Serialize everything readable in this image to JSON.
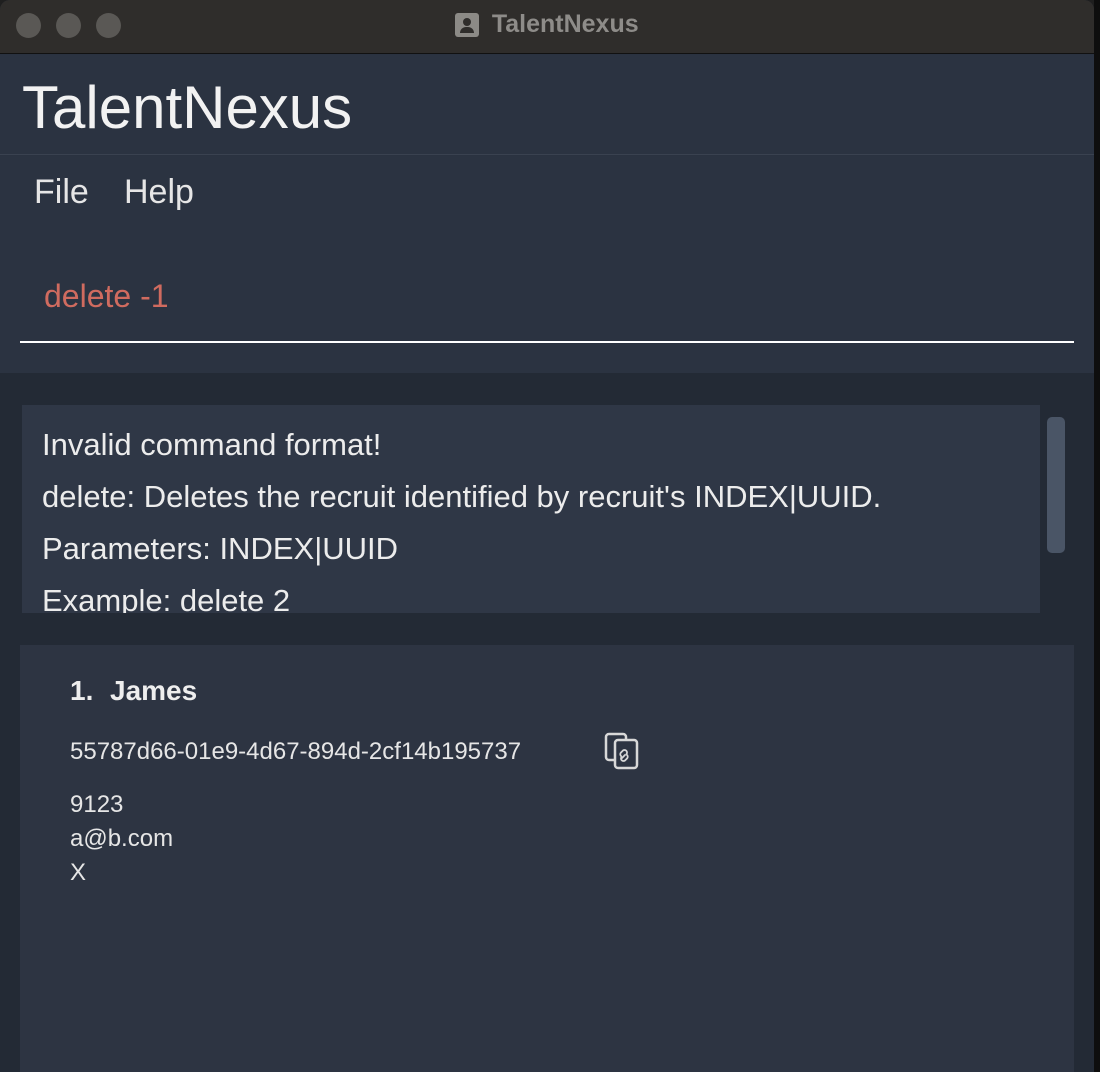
{
  "window": {
    "title": "TalentNexus"
  },
  "header": {
    "app_name": "TalentNexus"
  },
  "menu": {
    "items": [
      "File",
      "Help"
    ]
  },
  "command": {
    "value": "delete -1",
    "color": "#d06b5f"
  },
  "result": {
    "lines": [
      "Invalid command format!",
      "delete: Deletes the recruit identified by recruit's INDEX|UUID.",
      "Parameters: INDEX|UUID",
      "Example: delete 2"
    ]
  },
  "recruits": [
    {
      "index": "1.",
      "name": "James",
      "uuid": "55787d66-01e9-4d67-894d-2cf14b195737",
      "phone": "9123",
      "email": "a@b.com",
      "address": "X"
    }
  ],
  "icons": {
    "copy": "copy-link-icon",
    "window": "app-window-icon"
  }
}
